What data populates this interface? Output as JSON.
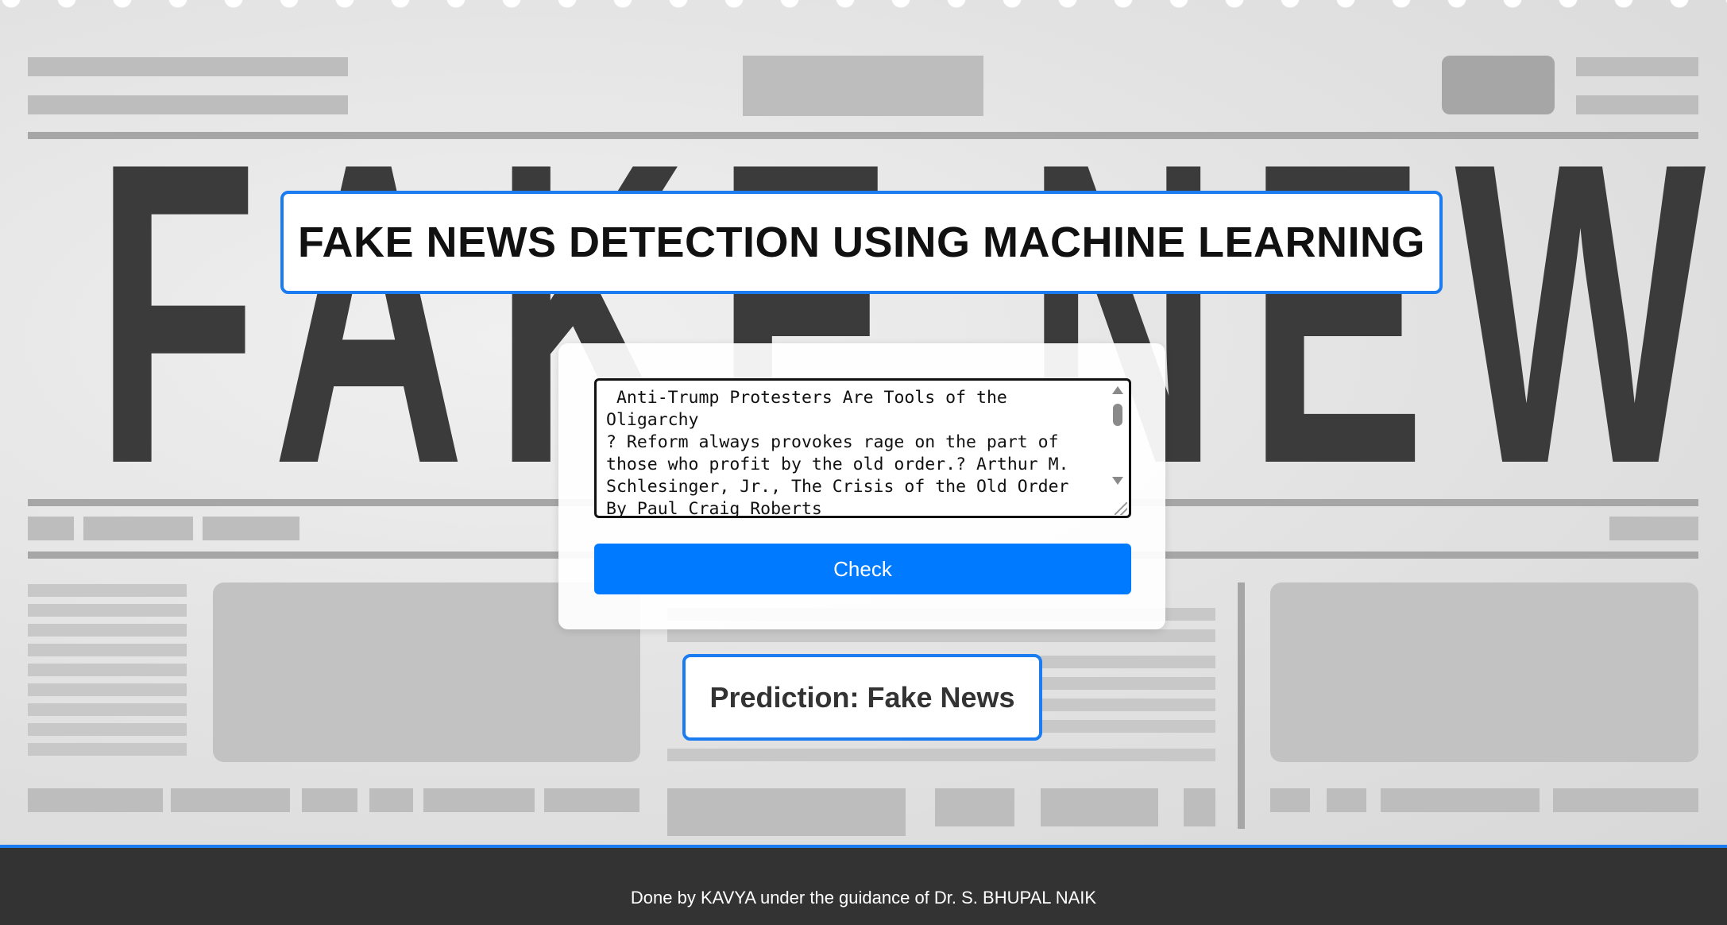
{
  "page": {
    "background_headline": "FAKE NEWS",
    "title": "FAKE NEWS DETECTION USING MACHINE LEARNING"
  },
  "form": {
    "news_text": " Anti-Trump Protesters Are Tools of the Oligarchy\n? Reform always provokes rage on the part of\nthose who profit by the old order.? Arthur M.\nSchlesinger, Jr., The Crisis of the Old Order\nBy Paul Craig Roberts\n Who are the anti-Trump protesters besmirching",
    "check_label": "Check"
  },
  "result": {
    "prediction": "Prediction: Fake News"
  },
  "footer": {
    "credit": "Done by KAVYA under the guidance of Dr. S. BHUPAL NAIK"
  },
  "colors": {
    "accent": "#1a7cf0",
    "button": "#007bff",
    "footer_bg": "#333333",
    "headline_bg": "#3b3b3b"
  }
}
